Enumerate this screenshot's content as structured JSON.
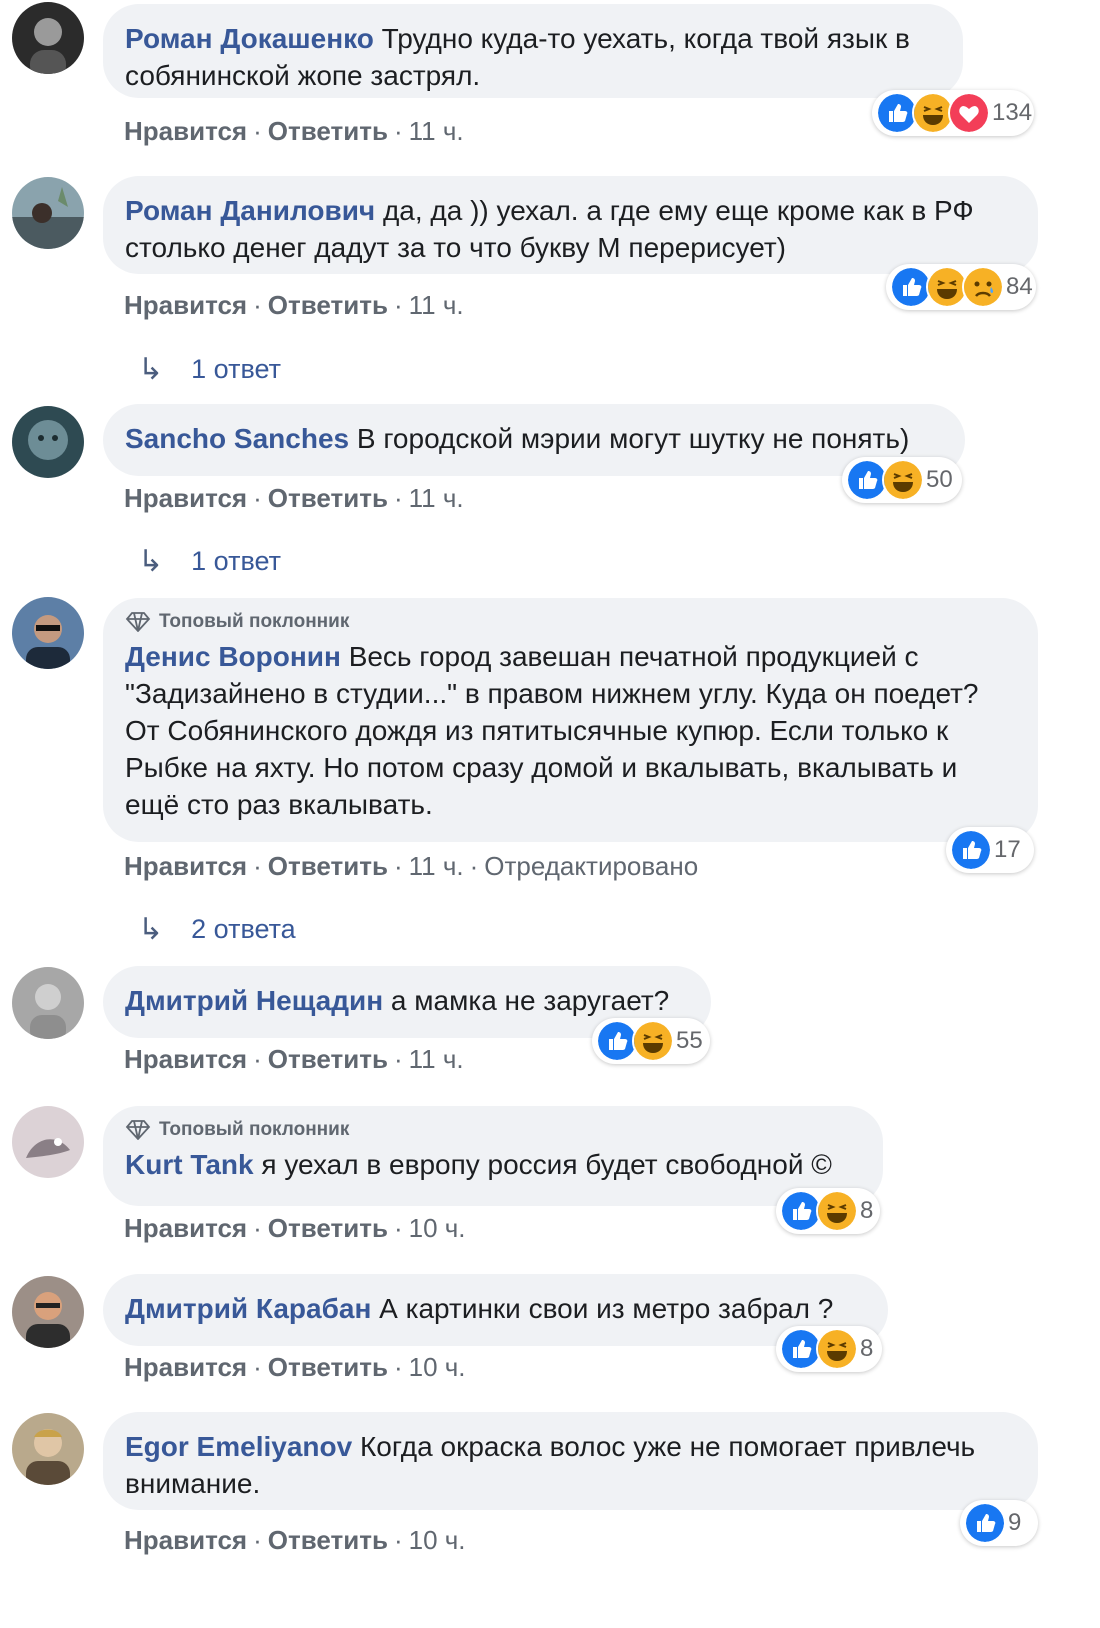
{
  "ui": {
    "like_label": "Нравится",
    "reply_label": "Ответить",
    "separator": "·",
    "reply_arrow": "↳",
    "edited_label": "Отредактировано",
    "top_fan_label": "Топовый поклонник"
  },
  "comments": [
    {
      "author": "Роман Докашенко",
      "text": "Трудно куда-то уехать, когда твой язык в собянинской жопе застрял.",
      "time": "11 ч.",
      "reactions": [
        "like",
        "haha",
        "love"
      ],
      "reaction_count": "134"
    },
    {
      "author": "Роман Данилович",
      "text": "да, да )) уехал. а где ему еще кроме как в РФ столько денег дадут за то что букву М перерисует)",
      "time": "11 ч.",
      "reactions": [
        "like",
        "haha",
        "sad"
      ],
      "reaction_count": "84",
      "replies": "1 ответ"
    },
    {
      "author": "Sancho Sanches",
      "text": "В городской мэрии могут шутку не понять)",
      "time": "11 ч.",
      "reactions": [
        "like",
        "haha"
      ],
      "reaction_count": "50",
      "replies": "1 ответ"
    },
    {
      "author": "Денис Воронин",
      "top_fan": true,
      "text": "Весь город завешан печатной продукцией с \"Задизайнено в студии...\" в правом нижнем углу. Куда он поедет? От Собянинского дождя из пятитысячные купюр. Если только к Рыбке на яхту. Но потом сразу домой и вкалывать, вкалывать и ещё сто раз вкалывать.",
      "time": "11 ч.",
      "edited": true,
      "reactions": [
        "like"
      ],
      "reaction_count": "17",
      "replies": "2 ответа"
    },
    {
      "author": "Дмитрий Нещадин",
      "text": "а мамка не заругает?",
      "time": "11 ч.",
      "reactions": [
        "like",
        "haha"
      ],
      "reaction_count": "55"
    },
    {
      "author": "Kurt Tank",
      "top_fan": true,
      "text": "я уехал в европу россия будет свободной ©",
      "time": "10 ч.",
      "reactions": [
        "like",
        "haha"
      ],
      "reaction_count": "8"
    },
    {
      "author": "Дмитрий Карабан",
      "text": "А картинки свои из метро забрал ?",
      "time": "10 ч.",
      "reactions": [
        "like",
        "haha"
      ],
      "reaction_count": "8"
    },
    {
      "author": "Egor Emeliyanov",
      "text": "Когда окраска волос уже не помогает привлечь внимание.",
      "time": "10 ч.",
      "reactions": [
        "like"
      ],
      "reaction_count": "9"
    }
  ],
  "colors": {
    "author": "#385898",
    "bubble": "#f0f2f5",
    "meta": "#606770",
    "like": "#1877f2",
    "haha": "#f7b125",
    "love": "#f33e58"
  }
}
